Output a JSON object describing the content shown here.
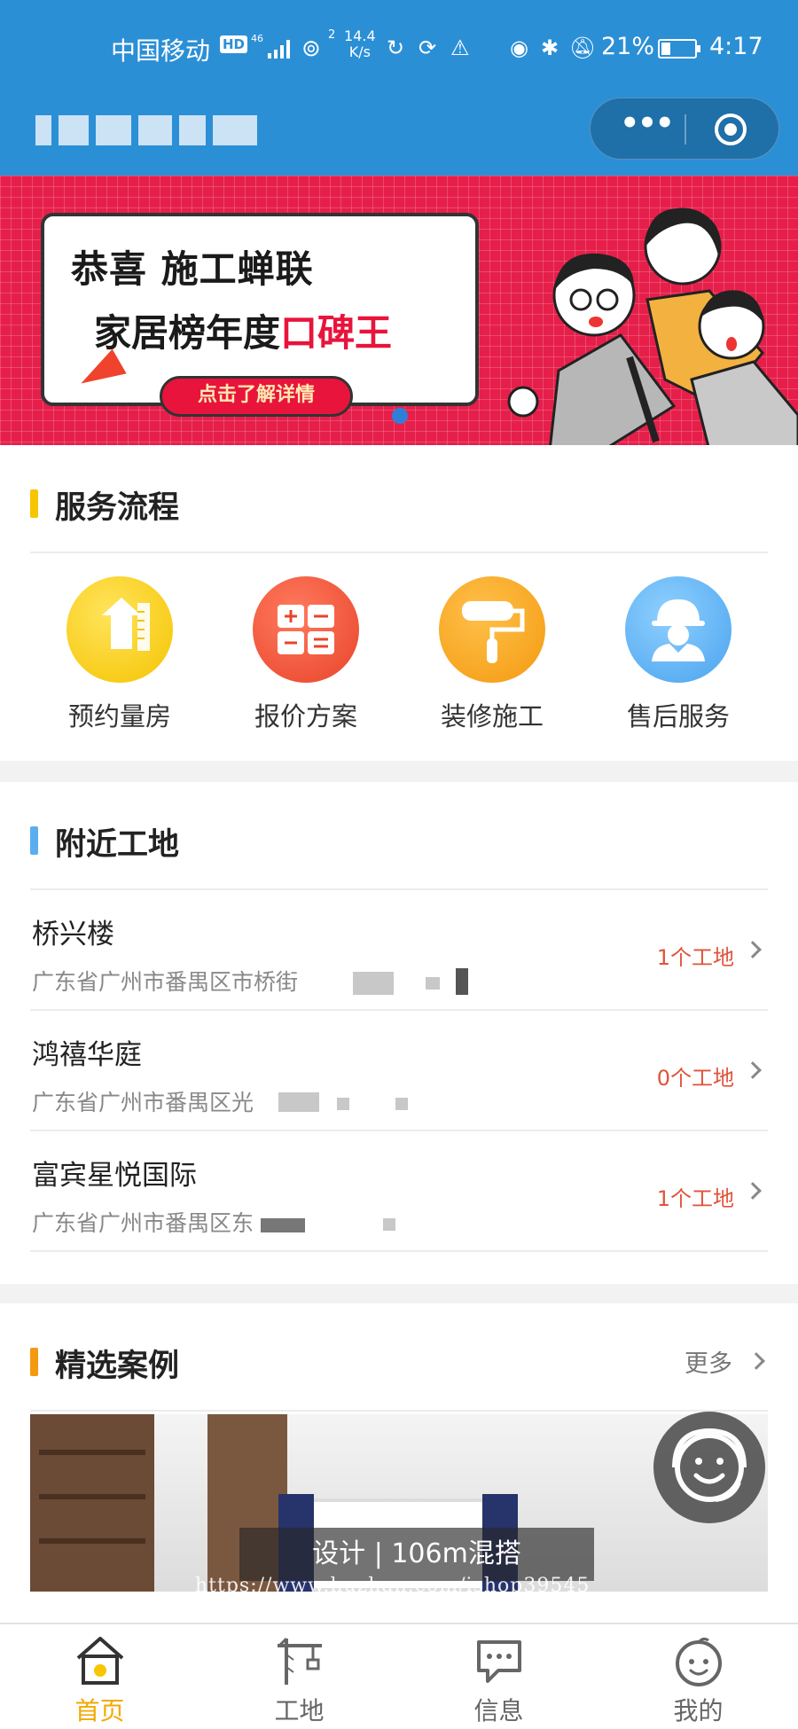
{
  "status_bar": {
    "carrier": "中国移动",
    "hd": "HD",
    "network": "46",
    "wifi_sup": "2",
    "speed_value": "14.4",
    "speed_unit": "K/s",
    "battery": "21%",
    "time": "4:17"
  },
  "banner": {
    "line1": "恭喜  施工蝉联",
    "line2_prefix": "家居榜年度",
    "line2_highlight": "口碑王",
    "button": "点击了解详情"
  },
  "services": {
    "title": "服务流程",
    "items": [
      {
        "label": "预约量房",
        "icon": "house-ruler-icon",
        "color": "#f9c81a"
      },
      {
        "label": "报价方案",
        "icon": "calculator-icon",
        "color": "#ef5437"
      },
      {
        "label": "装修施工",
        "icon": "paint-roller-icon",
        "color": "#f7a319"
      },
      {
        "label": "售后服务",
        "icon": "worker-helmet-icon",
        "color": "#5aaef0"
      }
    ]
  },
  "nearby": {
    "title": "附近工地",
    "sites": [
      {
        "name": "桥兴楼",
        "address": "广东省广州市番禺区市桥街",
        "count": "1个工地"
      },
      {
        "name": "鸿禧华庭",
        "address": "广东省广州市番禺区光",
        "count": "0个工地"
      },
      {
        "name": "富宾星悦国际",
        "address": "广东省广州市番禺区东",
        "count": "1个工地"
      }
    ]
  },
  "cases": {
    "title": "精选案例",
    "more": "更多",
    "caption": "设计 | 106m混搭"
  },
  "watermark": "https://www.huzhan.com/ishop39545",
  "tabbar": [
    {
      "label": "首页",
      "icon": "home-icon",
      "active": true
    },
    {
      "label": "工地",
      "icon": "crane-icon",
      "active": false
    },
    {
      "label": "信息",
      "icon": "chat-bubble-icon",
      "active": false
    },
    {
      "label": "我的",
      "icon": "smiley-face-icon",
      "active": false
    }
  ],
  "colors": {
    "header_blue": "#2b8fd6",
    "accent_yellow": "#f2a900",
    "count_red": "#e0533a"
  }
}
